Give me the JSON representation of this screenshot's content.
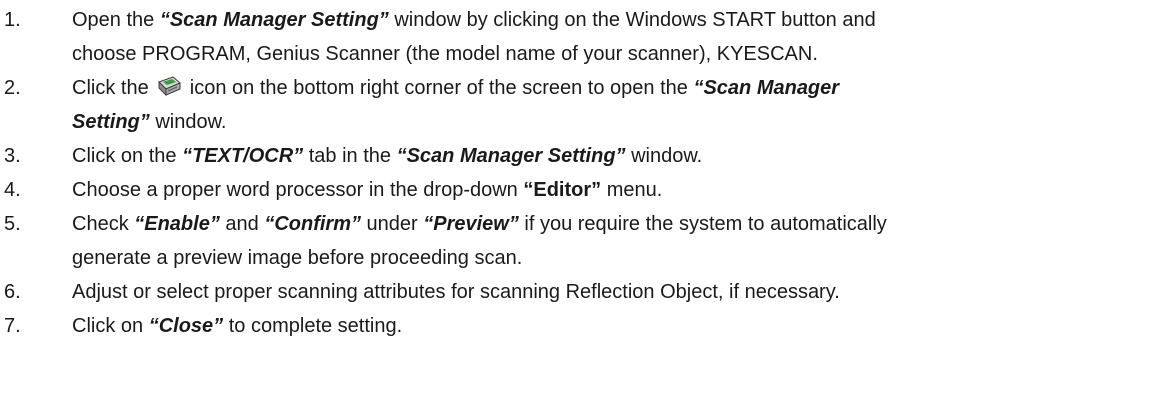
{
  "steps": [
    {
      "number": "1.",
      "l1": {
        "a": "Open the ",
        "b": "“Scan Manager Setting”",
        "c": " window by clicking on the Windows START button and"
      },
      "l2": "choose PROGRAM, Genius Scanner (the model name of your scanner), KYESCAN."
    },
    {
      "number": "2.",
      "l1": {
        "a": "Click the ",
        "icon": "scanner-icon",
        "c": " icon on the bottom right corner of the screen to open the ",
        "d": "“Scan Manager"
      },
      "l2": {
        "a": "Setting”",
        "b": " window."
      }
    },
    {
      "number": "3.",
      "l1": {
        "a": "Click on the ",
        "b": "“TEXT/OCR”",
        "c": " tab in the ",
        "d": "“Scan Manager Setting”",
        "e": " window."
      }
    },
    {
      "number": "4.",
      "l1": {
        "a": "Choose a proper word processor in the drop-down ",
        "b": "“Editor”",
        "c": " menu."
      }
    },
    {
      "number": "5.",
      "l1": {
        "a": "Check ",
        "b": "“Enable”",
        "c": " and ",
        "d": "“Confirm”",
        "e": " under ",
        "f": "“Preview”",
        "g": " if you require the system to automatically"
      },
      "l2": "generate a preview image before proceeding scan."
    },
    {
      "number": "6.",
      "l1": "Adjust or select proper scanning attributes for scanning Reflection Object, if necessary."
    },
    {
      "number": "7.",
      "l1": {
        "a": "Click on ",
        "b": "“Close”",
        "c": " to complete setting."
      }
    }
  ]
}
